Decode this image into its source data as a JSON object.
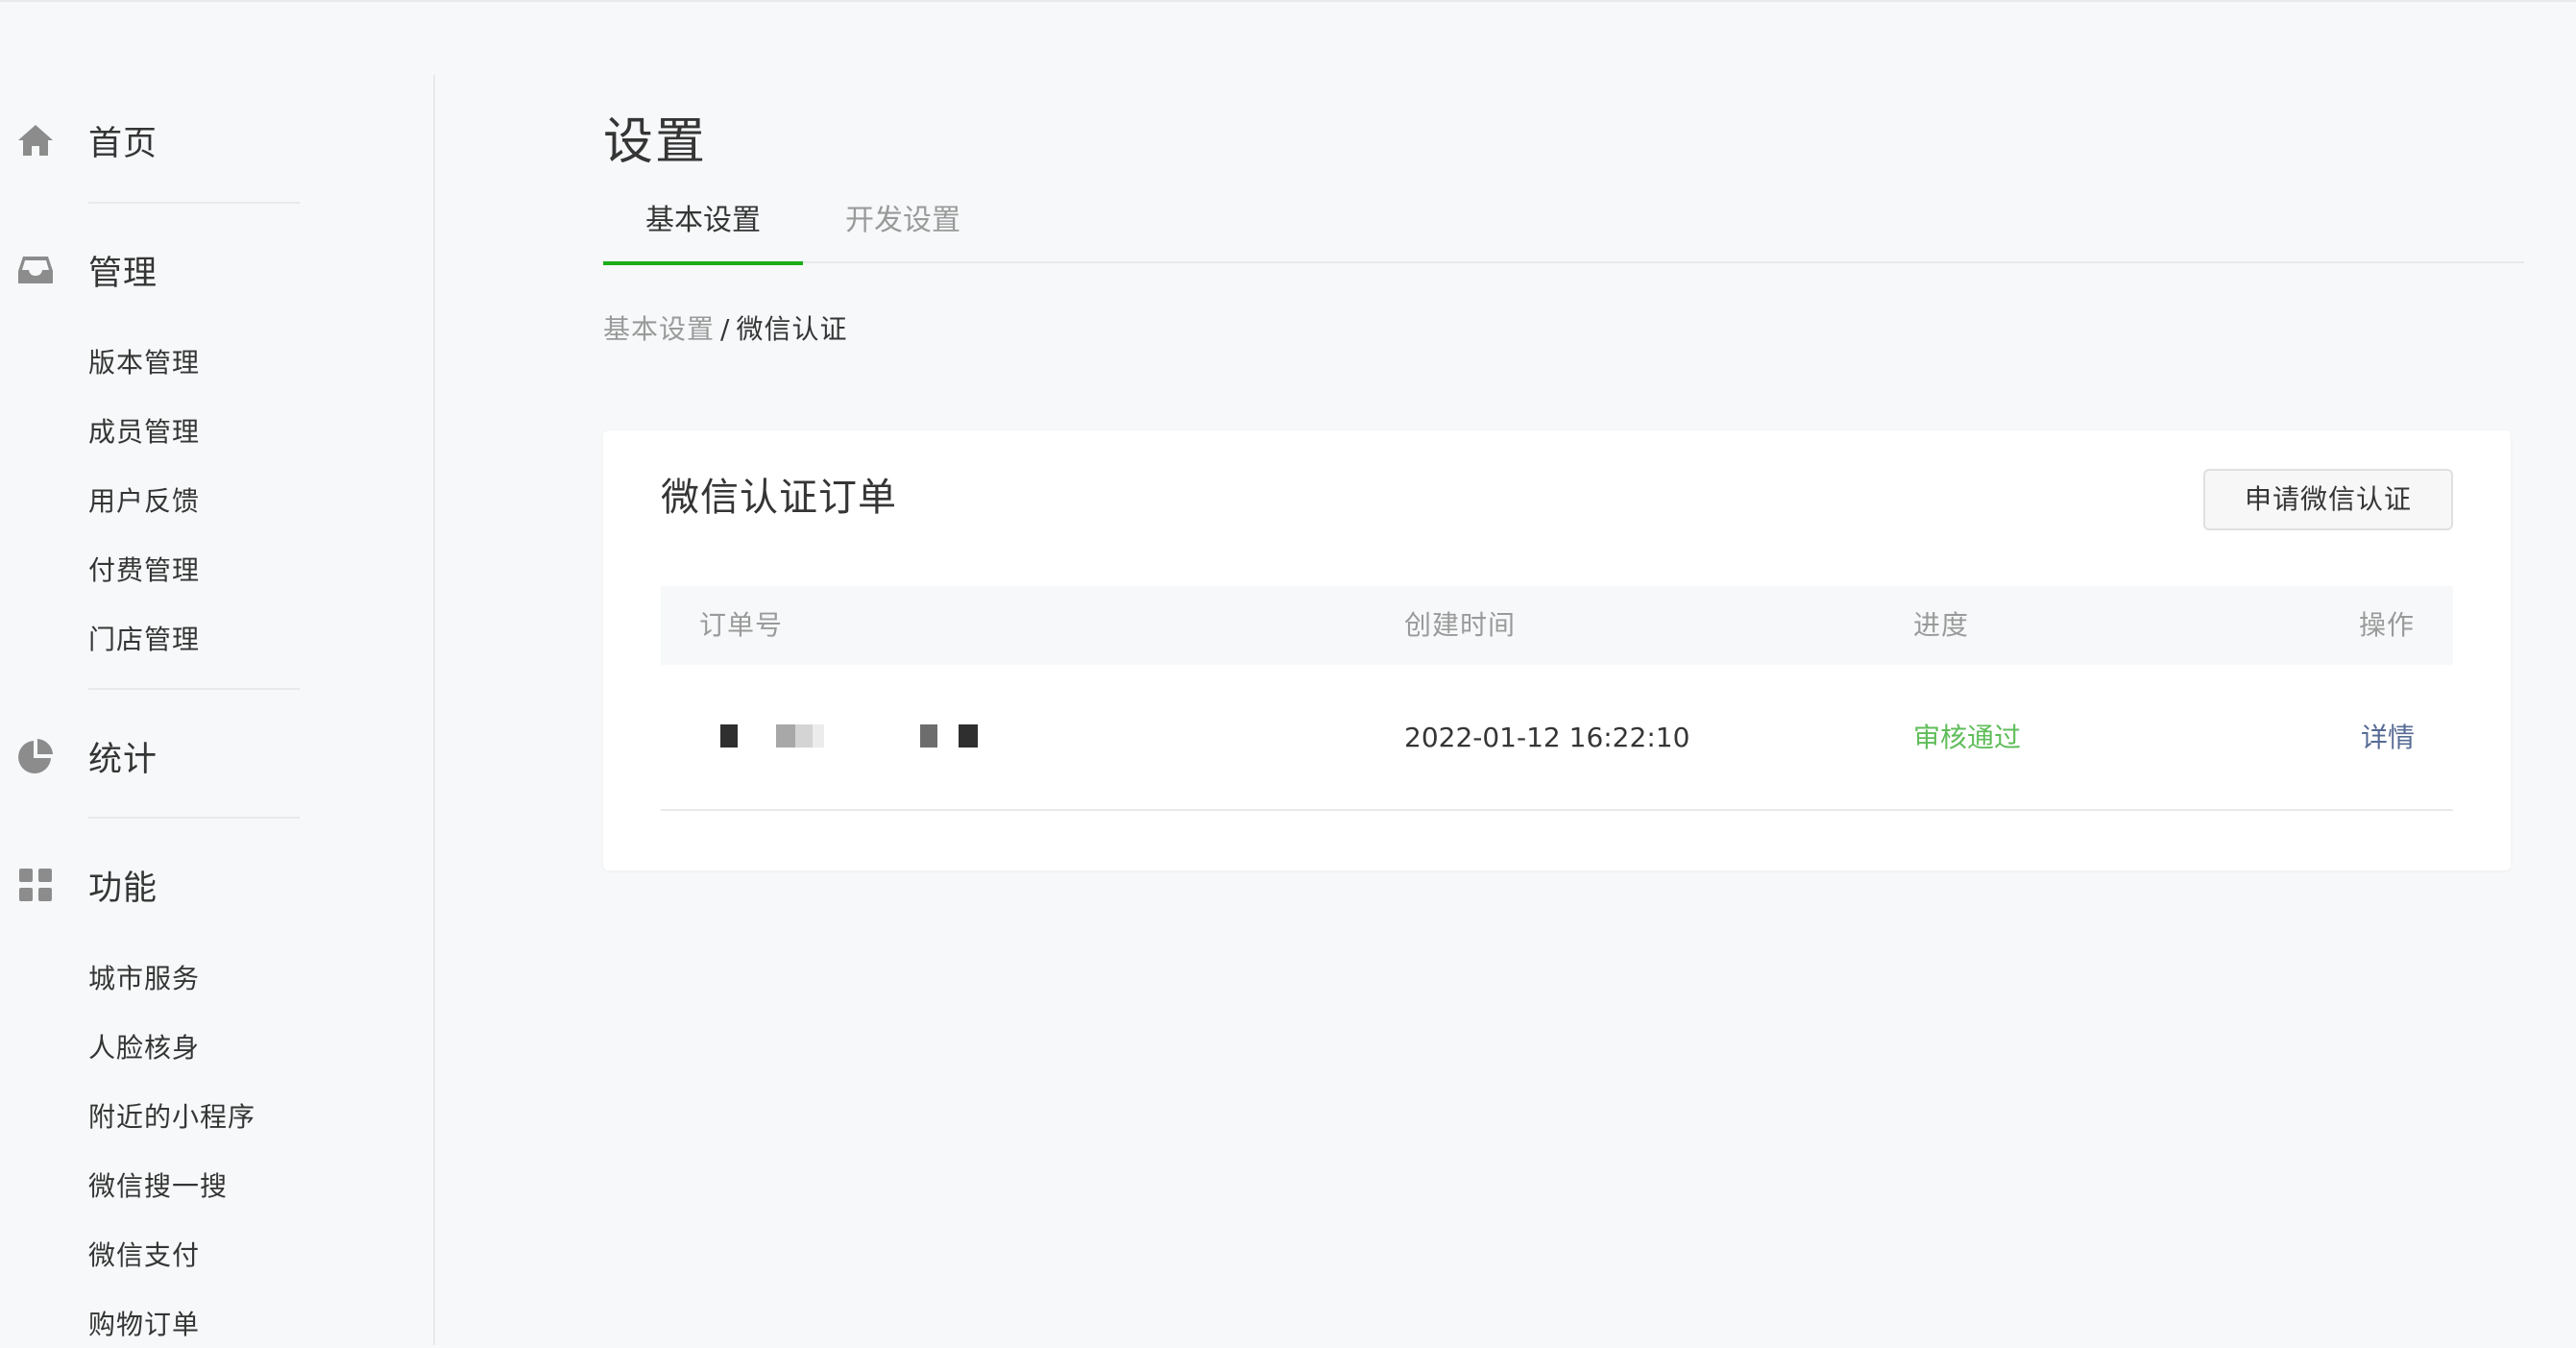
{
  "sidebar": {
    "home": {
      "label": "首页",
      "icon": "home-icon"
    },
    "manage": {
      "label": "管理",
      "icon": "inbox-icon",
      "items": [
        "版本管理",
        "成员管理",
        "用户反馈",
        "付费管理",
        "门店管理"
      ]
    },
    "stats": {
      "label": "统计",
      "icon": "pie-chart-icon"
    },
    "features": {
      "label": "功能",
      "icon": "grid-icon",
      "items": [
        "城市服务",
        "人脸核身",
        "附近的小程序",
        "微信搜一搜",
        "微信支付",
        "购物订单"
      ]
    }
  },
  "page": {
    "title": "设置",
    "tabs": [
      {
        "label": "基本设置",
        "active": true
      },
      {
        "label": "开发设置",
        "active": false
      }
    ],
    "breadcrumb": {
      "parent": "基本设置",
      "separator": "/",
      "current": "微信认证"
    }
  },
  "card": {
    "title": "微信认证订单",
    "apply_button": "申请微信认证",
    "columns": [
      "订单号",
      "创建时间",
      "进度",
      "操作"
    ],
    "rows": [
      {
        "order_id": "",
        "created_at": "2022-01-12 16:22:10",
        "status": "审核通过",
        "action": "详情"
      }
    ]
  },
  "colors": {
    "accent_green": "#1aad19",
    "status_green": "#5fbd59",
    "link_blue": "#576b95",
    "muted_text": "#9a9a9a",
    "primary_text": "#353535",
    "background": "#f6f8f9"
  }
}
